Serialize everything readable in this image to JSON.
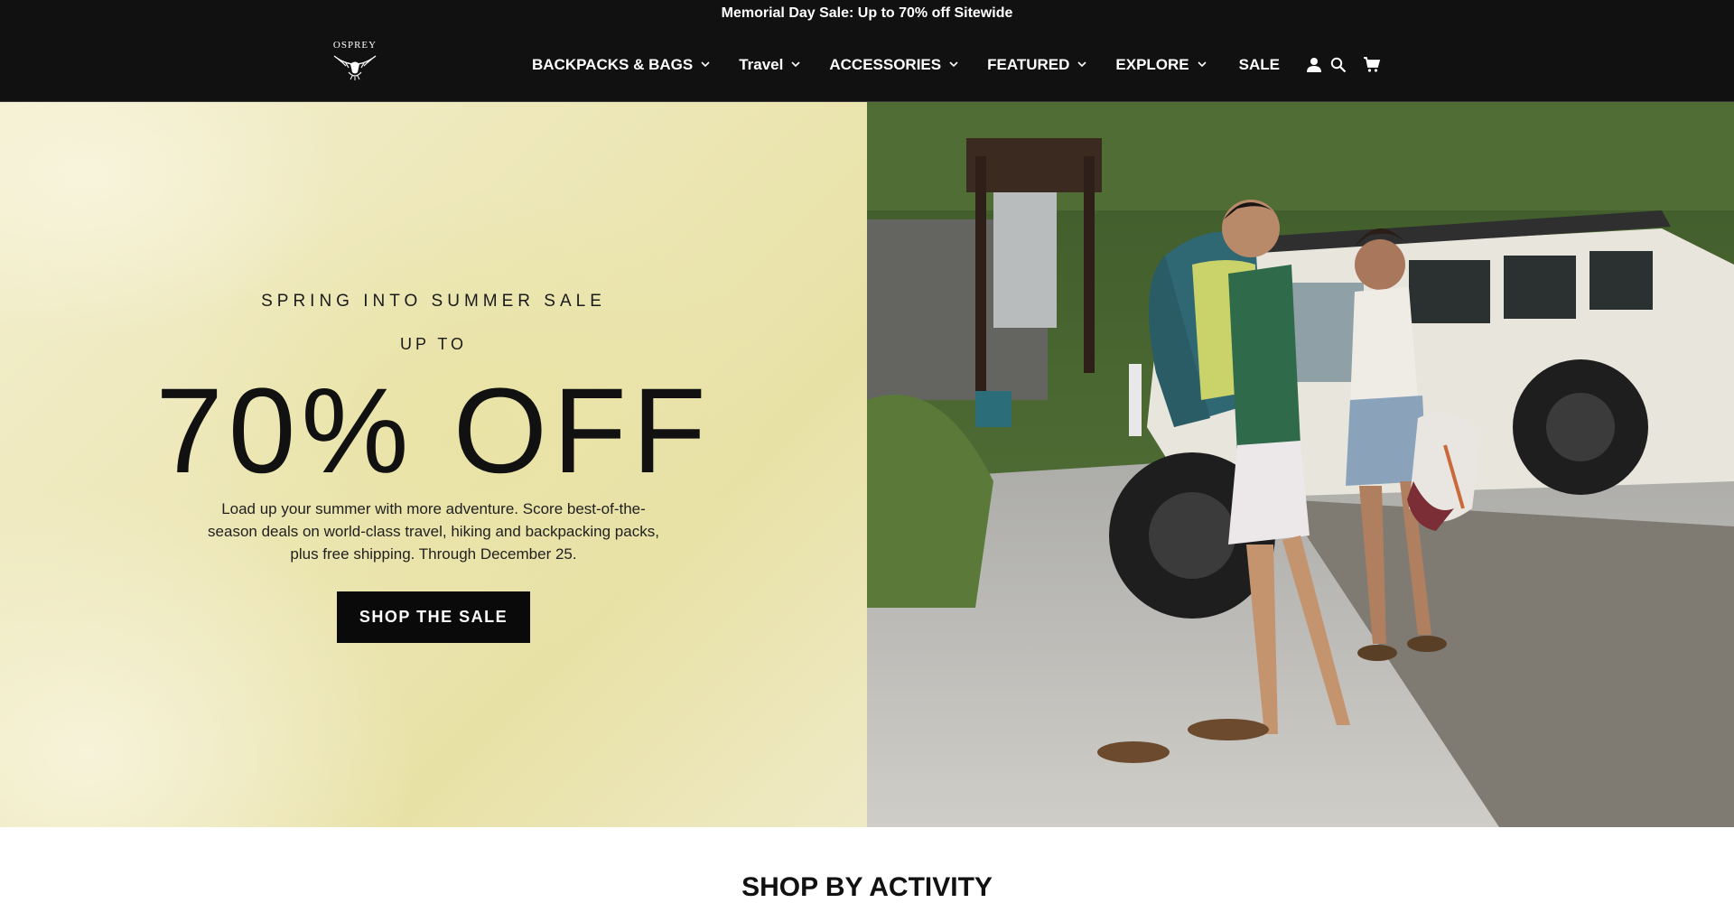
{
  "announcement": {
    "text": "Memorial Day Sale: Up to 70% off Sitewide"
  },
  "header": {
    "logo_text": "OSPREY",
    "nav": [
      {
        "label": "BACKPACKS & BAGS",
        "has_dropdown": true
      },
      {
        "label": "Travel",
        "has_dropdown": true
      },
      {
        "label": "ACCESSORIES",
        "has_dropdown": true
      },
      {
        "label": "FEATURED",
        "has_dropdown": true
      },
      {
        "label": "EXPLORE",
        "has_dropdown": true
      },
      {
        "label": "SALE",
        "has_dropdown": false
      }
    ],
    "icons": [
      "user-icon",
      "search-icon",
      "cart-icon"
    ]
  },
  "hero": {
    "eyebrow": "SPRING INTO SUMMER SALE",
    "up_to": "UP TO",
    "headline": "70% OFF",
    "description": "Load up your summer with more adventure. Score best-of-the-season deals on world-class travel, hiking and backpacking packs, plus free shipping. Through December 25.",
    "cta_label": "SHOP THE SALE",
    "image_alt_icon": "photo-couple-with-packs-by-truck"
  },
  "sections": {
    "shop_by_activity": "SHOP BY ACTIVITY"
  },
  "colors": {
    "header_bg": "#111111",
    "hero_left_bg": "#ece6b4",
    "cta_bg": "#0a0a0a",
    "text_light": "#ffffff"
  }
}
